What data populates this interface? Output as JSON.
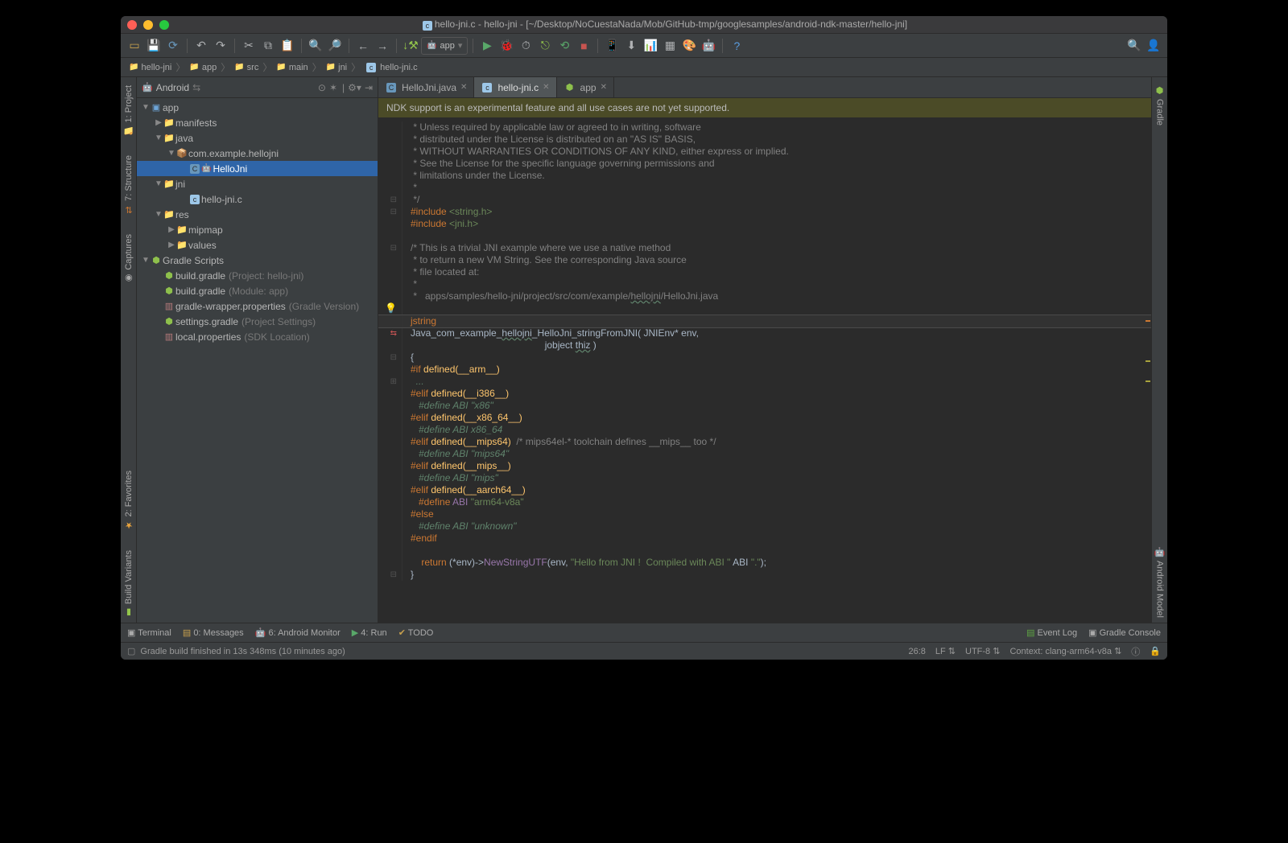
{
  "window": {
    "title": "hello-jni.c - hello-jni - [~/Desktop/NoCuestaNada/Mob/GitHub-tmp/googlesamples/android-ndk-master/hello-jni]"
  },
  "toolbar": {
    "run_config": "app"
  },
  "breadcrumb": [
    "hello-jni",
    "app",
    "src",
    "main",
    "jni",
    "hello-jni.c"
  ],
  "project_panel": {
    "title": "Android",
    "tree": {
      "app": "app",
      "manifests": "manifests",
      "java": "java",
      "pkg": "com.example.hellojni",
      "class_hello": "HelloJni",
      "jni": "jni",
      "file_c": "hello-jni.c",
      "res": "res",
      "mipmap": "mipmap",
      "values": "values",
      "gradle_scripts": "Gradle Scripts",
      "bg1": "build.gradle",
      "bg1_hint": "(Project: hello-jni)",
      "bg2": "build.gradle",
      "bg2_hint": "(Module: app)",
      "gwp": "gradle-wrapper.properties",
      "gwp_hint": "(Gradle Version)",
      "sg": "settings.gradle",
      "sg_hint": "(Project Settings)",
      "lp": "local.properties",
      "lp_hint": "(SDK Location)"
    }
  },
  "editor": {
    "tabs": [
      {
        "label": "HelloJni.java",
        "type": "j"
      },
      {
        "label": "hello-jni.c",
        "type": "c",
        "active": true
      },
      {
        "label": "app",
        "type": "gradle"
      }
    ],
    "banner": "NDK support is an experimental feature and all use cases are not yet supported."
  },
  "tool_windows": {
    "terminal": "Terminal",
    "messages": "0: Messages",
    "android_mon": "6: Android Monitor",
    "run": "4: Run",
    "todo": "TODO",
    "event_log": "Event Log",
    "gradle_console": "Gradle Console",
    "project": "1: Project",
    "structure": "7: Structure",
    "captures": "Captures",
    "favorites": "2: Favorites",
    "build_variants": "Build Variants",
    "gradle": "Gradle",
    "android_model": "Android Model"
  },
  "status": {
    "msg": "Gradle build finished in 13s 348ms (10 minutes ago)",
    "pos": "26:8",
    "le": "LF",
    "enc": "UTF-8",
    "context": "Context: clang-arm64-v8a"
  },
  "code": {
    "l1": " * Unless required by applicable law or agreed to in writing, software",
    "l2": " * distributed under the License is distributed on an \"AS IS\" BASIS,",
    "l3": " * WITHOUT WARRANTIES OR CONDITIONS OF ANY KIND, either express or implied.",
    "l4": " * See the License for the specific language governing permissions and",
    "l5": " * limitations under the License.",
    "l6": " *",
    "l7": " */",
    "i1a": "#include ",
    "i1b": "<string.h>",
    "i2a": "#include ",
    "i2b": "<jni.h>",
    "c1": "/* This is a trivial JNI example where we use a native method",
    "c2": " * to return a new VM String. See the corresponding Java source",
    "c3": " * file located at:",
    "c4": " *",
    "c5a": " *   apps/samples/hello-jni/project/src/com/example/",
    "c5b": "hellojni",
    "c5c": "/HelloJni.java",
    "js": "jstring",
    "fn1": "Java_com_example_",
    "fn1b": "hellojni",
    "fn1c": "_HelloJni_stringFromJNI( JNIEnv* env,",
    "fn2": "                                                  jobject ",
    "fn2b": "thiz",
    "fn2c": " )",
    "ob": "{",
    "if1a": "#if",
    "if1b": " defined(__arm__)",
    "dots": "  ...",
    "e1a": "#elif",
    "e1b": " defined(__i386__)",
    "d1a": "   #define ",
    "d1b": "ABI ",
    "d1c": "\"x86\"",
    "e2a": "#elif",
    "e2b": " defined(__x86_64__)",
    "d2a": "   #define ",
    "d2b": "ABI x86_64",
    "e3a": "#elif",
    "e3b": " defined(__mips64)",
    "e3c": "  /* mips64el-* toolchain defines __mips__ too */",
    "d3a": "   #define ",
    "d3b": "ABI \"mips64\"",
    "e4a": "#elif",
    "e4b": " defined(__mips__)",
    "d4a": "   #define ",
    "d4b": "ABI \"mips\"",
    "e5a": "#elif",
    "e5b": " defined(__aarch64__)",
    "d5a": "   #define ",
    "d5b": "ABI ",
    "d5c": "\"arm64-v8a\"",
    "els": "#else",
    "d6a": "   #define ",
    "d6b": "ABI \"unknown\"",
    "endif": "#endif",
    "ret1": "    return ",
    "ret2": "(*env)->",
    "ret3": "NewStringUTF",
    "ret4": "(env, ",
    "ret5": "\"Hello from JNI !  Compiled with ABI \"",
    "ret6": " ABI ",
    "ret7": "\".\"",
    "ret8": ");",
    "cb": "}"
  }
}
